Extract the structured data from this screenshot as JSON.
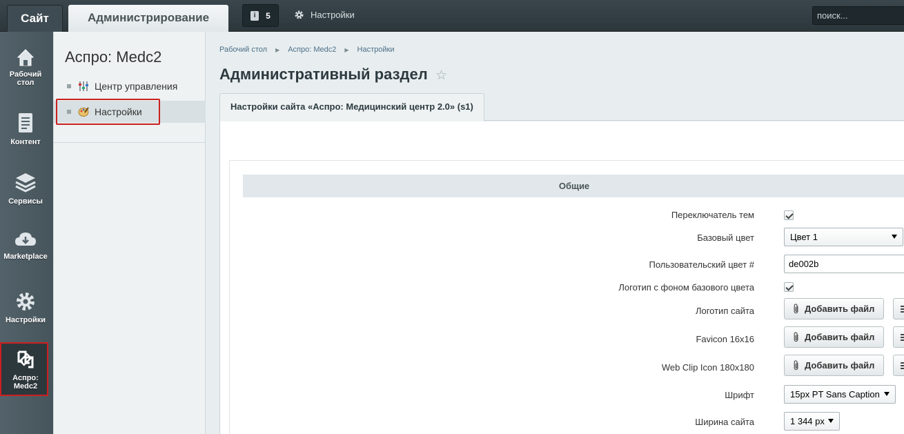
{
  "topbar": {
    "site_tab": "Сайт",
    "admin_tab": "Администрирование",
    "notifications_count": "5",
    "settings_label": "Настройки",
    "search_placeholder": "поиск..."
  },
  "leftnav": {
    "items": [
      {
        "label": "Рабочий стол",
        "icon": "home-icon"
      },
      {
        "label": "Контент",
        "icon": "document-icon"
      },
      {
        "label": "Сервисы",
        "icon": "layers-icon"
      },
      {
        "label": "Marketplace",
        "icon": "cloud-download-icon"
      },
      {
        "label": "Настройки",
        "icon": "gear-icon"
      },
      {
        "label": "Аспро: Medc2",
        "icon": "aspro-logo-icon",
        "active": true
      }
    ]
  },
  "submenu": {
    "title": "Аспро: Medc2",
    "items": [
      {
        "label": "Центр управления",
        "icon": "sliders-icon"
      },
      {
        "label": "Настройки",
        "icon": "palette-icon",
        "selected": true
      }
    ]
  },
  "breadcrumb": [
    "Рабочий стол",
    "Аспро: Medc2",
    "Настройки"
  ],
  "page_title": "Административный раздел",
  "tab": "Настройки сайта «Аспро: Медицинский центр 2.0» (s1)",
  "section": "Общие",
  "form": {
    "theme_switcher": {
      "label": "Переключатель тем",
      "checked": true
    },
    "base_color": {
      "label": "Базовый цвет",
      "value": "Цвет 1"
    },
    "custom_color": {
      "label": "Пользовательский цвет #",
      "value": "de002b"
    },
    "logo_bg": {
      "label": "Логотип с фоном базового цвета",
      "checked": true
    },
    "site_logo": {
      "label": "Логотип сайта",
      "button": "Добавить файл"
    },
    "favicon": {
      "label": "Favicon 16x16",
      "button": "Добавить файл"
    },
    "webclip": {
      "label": "Web Clip Icon 180x180",
      "button": "Добавить файл"
    },
    "font": {
      "label": "Шрифт",
      "value": "15px PT Sans Caption"
    },
    "width": {
      "label": "Ширина сайта",
      "value": "1 344 px"
    }
  },
  "colors": {
    "accent_red": "#cc1f1f",
    "link": "#4b6e86"
  }
}
